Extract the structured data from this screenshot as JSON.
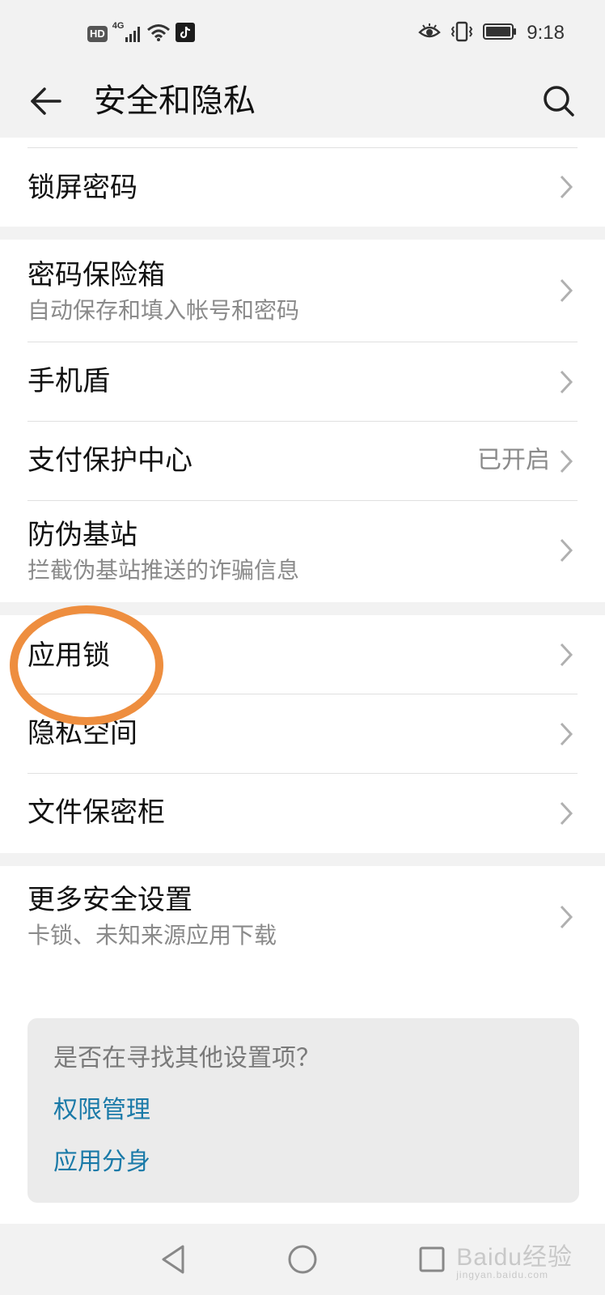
{
  "status": {
    "hd": "HD",
    "network": "4G",
    "time": "9:18"
  },
  "header": {
    "title": "安全和隐私"
  },
  "items": {
    "lock_screen": {
      "title": "锁屏密码"
    },
    "password_vault": {
      "title": "密码保险箱",
      "subtitle": "自动保存和填入帐号和密码"
    },
    "phone_shield": {
      "title": "手机盾"
    },
    "payment": {
      "title": "支付保护中心",
      "value": "已开启"
    },
    "fake_station": {
      "title": "防伪基站",
      "subtitle": "拦截伪基站推送的诈骗信息"
    },
    "app_lock": {
      "title": "应用锁"
    },
    "private_space": {
      "title": "隐私空间"
    },
    "file_safe": {
      "title": "文件保密柜"
    },
    "more_security": {
      "title": "更多安全设置",
      "subtitle": "卡锁、未知来源应用下载"
    }
  },
  "suggestion": {
    "question": "是否在寻找其他设置项？",
    "links": [
      "权限管理",
      "应用分身"
    ]
  },
  "watermark": {
    "brand": "Baidu经验",
    "url": "jingyan.baidu.com"
  },
  "colors": {
    "accent_link": "#1a7aa8",
    "highlight_circle": "#ee8e3f"
  }
}
